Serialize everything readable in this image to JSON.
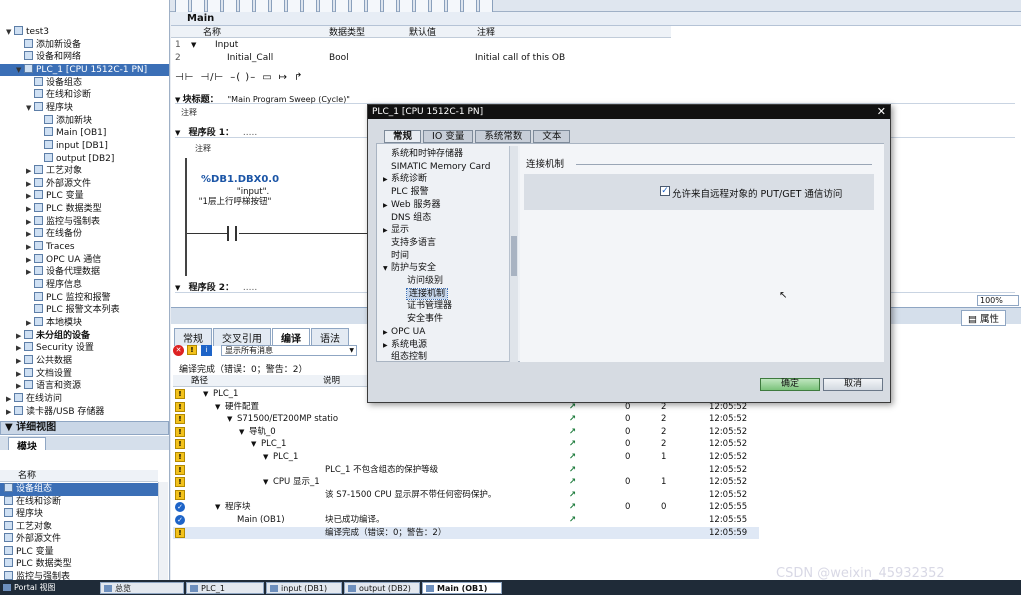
{
  "left_panel": {
    "tree": [
      {
        "label": "test3",
        "level": 0,
        "arrow": "▼"
      },
      {
        "label": "添加新设备",
        "level": 1,
        "arrow": ""
      },
      {
        "label": "设备和网络",
        "level": 1,
        "arrow": ""
      },
      {
        "label": "PLC_1 [CPU 1512C-1 PN]",
        "level": 1,
        "arrow": "▼",
        "selected": true
      },
      {
        "label": "设备组态",
        "level": 2,
        "arrow": ""
      },
      {
        "label": "在线和诊断",
        "level": 2,
        "arrow": ""
      },
      {
        "label": "程序块",
        "level": 2,
        "arrow": "▼"
      },
      {
        "label": "添加新块",
        "level": 3,
        "arrow": ""
      },
      {
        "label": "Main [OB1]",
        "level": 3,
        "arrow": ""
      },
      {
        "label": "input [DB1]",
        "level": 3,
        "arrow": ""
      },
      {
        "label": "output [DB2]",
        "level": 3,
        "arrow": ""
      },
      {
        "label": "工艺对象",
        "level": 2,
        "arrow": "▶"
      },
      {
        "label": "外部源文件",
        "level": 2,
        "arrow": "▶"
      },
      {
        "label": "PLC 变量",
        "level": 2,
        "arrow": "▶"
      },
      {
        "label": "PLC 数据类型",
        "level": 2,
        "arrow": "▶"
      },
      {
        "label": "监控与强制表",
        "level": 2,
        "arrow": "▶"
      },
      {
        "label": "在线备份",
        "level": 2,
        "arrow": "▶"
      },
      {
        "label": "Traces",
        "level": 2,
        "arrow": "▶"
      },
      {
        "label": "OPC UA 通信",
        "level": 2,
        "arrow": "▶"
      },
      {
        "label": "设备代理数据",
        "level": 2,
        "arrow": "▶"
      },
      {
        "label": "程序信息",
        "level": 2,
        "arrow": ""
      },
      {
        "label": "PLC 监控和报警",
        "level": 2,
        "arrow": ""
      },
      {
        "label": "PLC 报警文本列表",
        "level": 2,
        "arrow": ""
      },
      {
        "label": "本地模块",
        "level": 2,
        "arrow": "▶"
      },
      {
        "label": "未分组的设备",
        "level": 1,
        "arrow": "▶",
        "bold": true
      },
      {
        "label": "Security 设置",
        "level": 1,
        "arrow": "▶"
      },
      {
        "label": "公共数据",
        "level": 1,
        "arrow": "▶"
      },
      {
        "label": "文档设置",
        "level": 1,
        "arrow": "▶"
      },
      {
        "label": "语言和资源",
        "level": 1,
        "arrow": "▶"
      },
      {
        "label": "在线访问",
        "level": 0,
        "arrow": "▶"
      },
      {
        "label": "读卡器/USB 存储器",
        "level": 0,
        "arrow": "▶"
      }
    ],
    "detail_view_title": "详细视图",
    "detail_tab": "模块",
    "detail_col_header": "名称",
    "detail_items": [
      {
        "label": "设备组态"
      },
      {
        "label": "在线和诊断"
      },
      {
        "label": "程序块"
      },
      {
        "label": "工艺对象"
      },
      {
        "label": "外部源文件"
      },
      {
        "label": "PLC 变量"
      },
      {
        "label": "PLC 数据类型"
      },
      {
        "label": "监控与强制表"
      }
    ]
  },
  "editor": {
    "title": "Main",
    "interface_headers": [
      "名称",
      "数据类型",
      "默认值",
      "注释"
    ],
    "interface_rows": [
      {
        "no": "1",
        "name": "Input",
        "type": "",
        "default": "",
        "comment": ""
      },
      {
        "no": "2",
        "name": "Initial_Call",
        "type": "Bool",
        "default": "",
        "comment": "Initial call of this OB"
      }
    ],
    "block_title_label": "块标题：",
    "block_title_value": "\"Main Program Sweep (Cycle)\"",
    "comment_label": "注释",
    "network1_label": "程序段 1：",
    "network1_dots": ".....",
    "network1_comment": "注释",
    "contact_address": "%DB1.DBX0.0",
    "contact_db": "\"input\".",
    "contact_tag": "\"1层上行呼梯按钮\"",
    "network2_label": "程序段 2：",
    "network2_dots": ".....",
    "zoom": "100%"
  },
  "inspector": {
    "tabs": [
      "常规",
      "交叉引用",
      "编译",
      "语法"
    ],
    "active_tab": "编译",
    "properties_tab": "属性",
    "filter_value": "显示所有消息",
    "summary": "编译完成（错误：0；警告：2）",
    "col_path": "路径",
    "col_desc": "说明",
    "rows": [
      {
        "icon": "warn",
        "indent": 0,
        "arrow": "▼",
        "path": "PLC_1",
        "desc": "",
        "err": "0",
        "warn": "2",
        "time": "12:05:49",
        "goto": true
      },
      {
        "icon": "warn",
        "indent": 1,
        "arrow": "▼",
        "path": "硬件配置",
        "desc": "",
        "err": "0",
        "warn": "2",
        "time": "12:05:52",
        "goto": true
      },
      {
        "icon": "warn",
        "indent": 2,
        "arrow": "▼",
        "path": "S71500/ET200MP statio",
        "desc": "",
        "err": "0",
        "warn": "2",
        "time": "12:05:52",
        "goto": true
      },
      {
        "icon": "warn",
        "indent": 3,
        "arrow": "▼",
        "path": "导轨_0",
        "desc": "",
        "err": "0",
        "warn": "2",
        "time": "12:05:52",
        "goto": true
      },
      {
        "icon": "warn",
        "indent": 4,
        "arrow": "▼",
        "path": "PLC_1",
        "desc": "",
        "err": "0",
        "warn": "2",
        "time": "12:05:52",
        "goto": true
      },
      {
        "icon": "warn",
        "indent": 5,
        "arrow": "▼",
        "path": "PLC_1",
        "desc": "",
        "err": "0",
        "warn": "1",
        "time": "12:05:52",
        "goto": true
      },
      {
        "icon": "warn",
        "indent": 6,
        "arrow": "",
        "path": "",
        "desc": "PLC_1 不包含组态的保护等级",
        "err": "",
        "warn": "",
        "time": "12:05:52",
        "goto": true
      },
      {
        "icon": "warn",
        "indent": 5,
        "arrow": "▼",
        "path": "CPU 显示_1",
        "desc": "",
        "err": "0",
        "warn": "1",
        "time": "12:05:52",
        "goto": true
      },
      {
        "icon": "warn",
        "indent": 6,
        "arrow": "",
        "path": "",
        "desc": "该 S7-1500 CPU 显示屏不带任何密码保护。",
        "err": "",
        "warn": "",
        "time": "12:05:52",
        "goto": true
      },
      {
        "icon": "ok",
        "indent": 1,
        "arrow": "▼",
        "path": "程序块",
        "desc": "",
        "err": "0",
        "warn": "0",
        "time": "12:05:55",
        "goto": true
      },
      {
        "icon": "ok",
        "indent": 2,
        "arrow": "",
        "path": "Main (OB1)",
        "desc": "块已成功编译。",
        "err": "",
        "warn": "",
        "time": "12:05:55",
        "goto": true
      },
      {
        "icon": "warn",
        "indent": 0,
        "arrow": "",
        "path": "",
        "desc": "编译完成（错误：0；警告：2）",
        "err": "",
        "warn": "",
        "time": "12:05:59",
        "goto": false,
        "selected": true
      }
    ]
  },
  "dialog": {
    "title": "PLC_1 [CPU 1512C-1 PN]",
    "tabs": [
      "常规",
      "IO 变量",
      "系统常数",
      "文本"
    ],
    "active_tab": "常规",
    "nav": [
      {
        "label": "系统和时钟存储器",
        "level": 1,
        "arrow": ""
      },
      {
        "label": "SIMATIC Memory Card",
        "level": 1,
        "arrow": ""
      },
      {
        "label": "系统诊断",
        "level": 1,
        "arrow": "▶"
      },
      {
        "label": "PLC 报警",
        "level": 1,
        "arrow": ""
      },
      {
        "label": "Web 服务器",
        "level": 1,
        "arrow": "▶"
      },
      {
        "label": "DNS 组态",
        "level": 1,
        "arrow": ""
      },
      {
        "label": "显示",
        "level": 1,
        "arrow": "▶"
      },
      {
        "label": "支持多语言",
        "level": 1,
        "arrow": ""
      },
      {
        "label": "时间",
        "level": 1,
        "arrow": ""
      },
      {
        "label": "防护与安全",
        "level": 1,
        "arrow": "▼"
      },
      {
        "label": "访问级别",
        "level": 2,
        "arrow": ""
      },
      {
        "label": "连接机制",
        "level": 2,
        "arrow": "",
        "selected": true
      },
      {
        "label": "证书管理器",
        "level": 2,
        "arrow": ""
      },
      {
        "label": "安全事件",
        "level": 2,
        "arrow": ""
      },
      {
        "label": "OPC UA",
        "level": 1,
        "arrow": "▶"
      },
      {
        "label": "系统电源",
        "level": 1,
        "arrow": "▶"
      },
      {
        "label": "组态控制",
        "level": 1,
        "arrow": ""
      }
    ],
    "section_title": "连接机制",
    "checkbox_label": "允许来自远程对象的 PUT/GET 通信访问",
    "checkbox_checked": true,
    "ok_label": "确定",
    "cancel_label": "取消"
  },
  "taskbar": {
    "items": [
      {
        "label": "Portal 视图",
        "active": false
      },
      {
        "label": "总览",
        "active": false
      },
      {
        "label": "PLC_1",
        "active": false
      },
      {
        "label": "input (DB1)",
        "active": false
      },
      {
        "label": "output (DB2)",
        "active": false
      },
      {
        "label": "Main (OB1)",
        "active": true
      }
    ],
    "watermark": "CSDN @weixin_45932352"
  }
}
